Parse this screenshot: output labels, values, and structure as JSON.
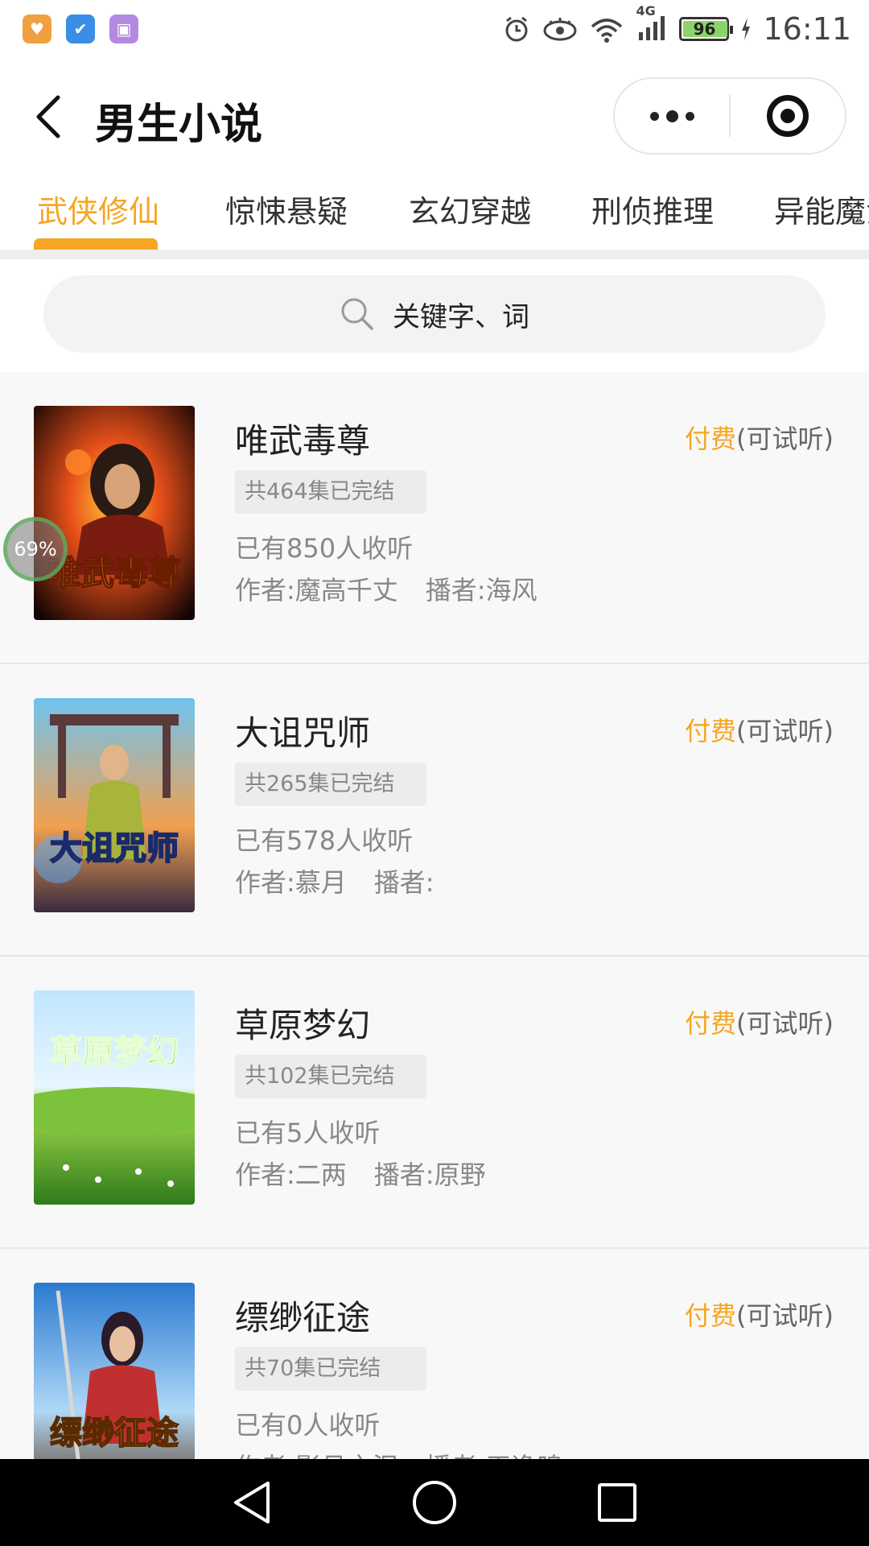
{
  "status_bar": {
    "time": "16:11",
    "battery": "96",
    "battery_level": 0.96,
    "network": "4G"
  },
  "header": {
    "title": "男生小说"
  },
  "tabs": [
    {
      "label": "武侠修仙",
      "active": true
    },
    {
      "label": "惊悚悬疑",
      "active": false
    },
    {
      "label": "玄幻穿越",
      "active": false
    },
    {
      "label": "刑侦推理",
      "active": false
    },
    {
      "label": "异能魔法",
      "active": false
    }
  ],
  "search": {
    "placeholder": "关键字、词"
  },
  "floating_progress": "69%",
  "books": [
    {
      "title": "唯武毒尊",
      "episodes": "共464集已完结",
      "listeners": "已有850人收听",
      "author": "作者:魔高千丈",
      "narrator": "播者:海风",
      "price_paid": "付费",
      "price_note": "(可试听)",
      "cover_text": "唯武毒尊"
    },
    {
      "title": "大诅咒师",
      "episodes": "共265集已完结",
      "listeners": "已有578人收听",
      "author": "作者:慕月",
      "narrator": "播者:",
      "price_paid": "付费",
      "price_note": "(可试听)",
      "cover_text": "大诅咒师"
    },
    {
      "title": "草原梦幻",
      "episodes": "共102集已完结",
      "listeners": "已有5人收听",
      "author": "作者:二两",
      "narrator": "播者:原野",
      "price_paid": "付费",
      "price_note": "(可试听)",
      "cover_text": "草原梦幻"
    },
    {
      "title": "缥缈征途",
      "episodes": "共70集已完结",
      "listeners": "已有0人收听",
      "author": "作者:影月之泪",
      "narrator": "播者:天逸鸣",
      "price_paid": "付费",
      "price_note": "(可试听)",
      "cover_text": "缥缈征途"
    }
  ],
  "colors": {
    "accent": "#f5a623",
    "text_primary": "#222222",
    "text_secondary": "#888888",
    "list_bg": "#f8f8f8"
  }
}
